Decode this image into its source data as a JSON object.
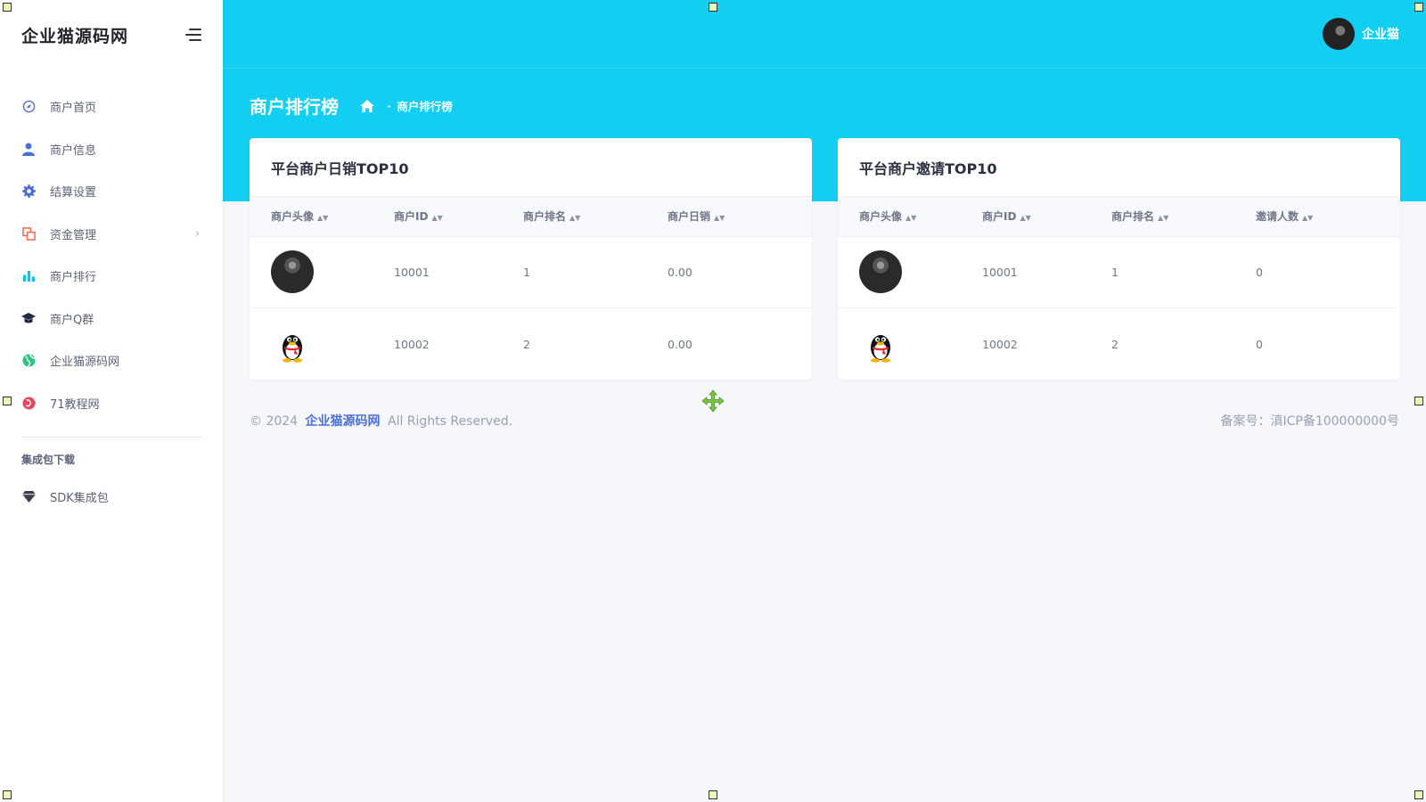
{
  "brand": {
    "title": "企业猫源码网"
  },
  "sidebar": {
    "items": [
      {
        "label": "商户首页",
        "icon": "compass-icon"
      },
      {
        "label": "商户信息",
        "icon": "user-icon"
      },
      {
        "label": "结算设置",
        "icon": "gear-icon"
      },
      {
        "label": "资金管理",
        "icon": "wallet-icon"
      },
      {
        "label": "商户排行",
        "icon": "bar-chart-icon"
      },
      {
        "label": "商户Q群",
        "icon": "graduation-cap-icon"
      },
      {
        "label": "企业猫源码网",
        "icon": "globe-icon"
      },
      {
        "label": "71教程网",
        "icon": "sphere-icon"
      }
    ],
    "section_title": "集成包下载",
    "section_items": [
      {
        "label": "SDK集成包",
        "icon": "diamond-icon"
      }
    ]
  },
  "header": {
    "username": "企业猫",
    "page_title": "商户排行榜",
    "breadcrumb": "商户排行榜",
    "color": "#12cef0"
  },
  "sales_card": {
    "title": "平台商户日销TOP10",
    "columns": [
      "商户头像",
      "商户ID",
      "商户排名",
      "商户日销"
    ],
    "rows": [
      {
        "id": "10001",
        "rank": "1",
        "value": "0.00"
      },
      {
        "id": "10002",
        "rank": "2",
        "value": "0.00"
      }
    ]
  },
  "invite_card": {
    "title": "平台商户邀请TOP10",
    "columns": [
      "商户头像",
      "商户ID",
      "商户排名",
      "邀请人数"
    ],
    "rows": [
      {
        "id": "10001",
        "rank": "1",
        "value": "0"
      },
      {
        "id": "10002",
        "rank": "2",
        "value": "0"
      }
    ]
  },
  "footer": {
    "copyright": "© 2024",
    "link": "企业猫源码网",
    "rights": "All Rights Reserved.",
    "icp": "备案号：滇ICP备100000000号"
  }
}
